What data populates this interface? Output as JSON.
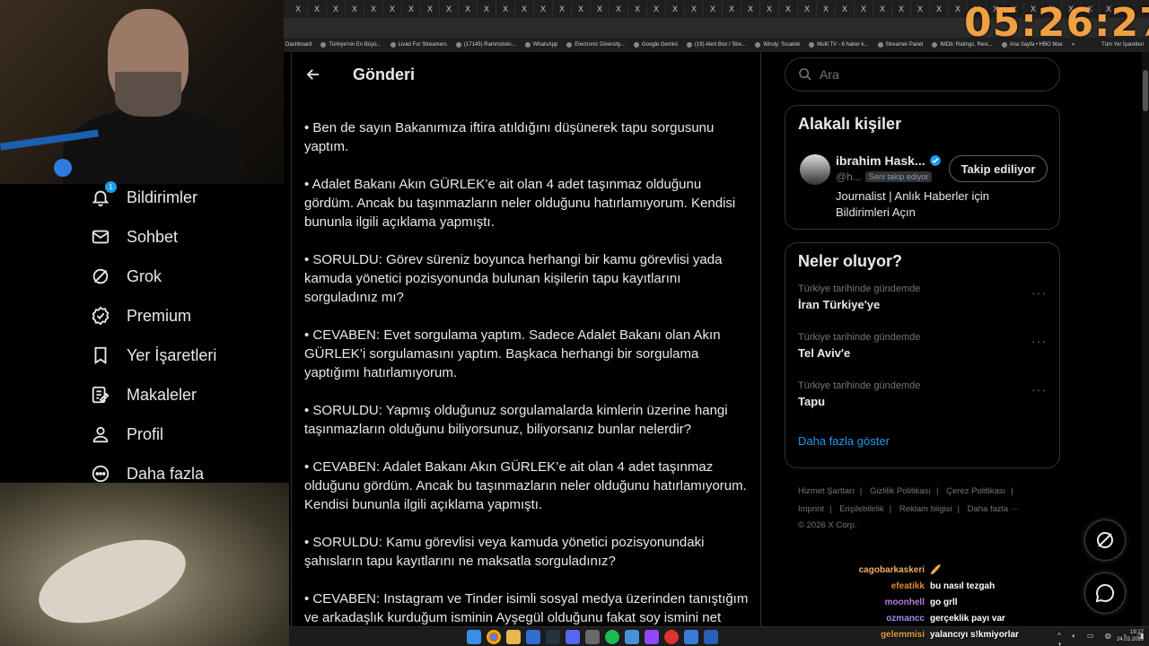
{
  "clock": "05:26:27",
  "browser": {
    "tab_close_glyph": "X",
    "tab_count": 44,
    "bookmarks": [
      "Dashboard",
      "Türkiye'nin En Büyü...",
      "Livad For Streamers",
      "(17145) Rammstein...",
      "WhatsApp",
      "Electronic Diversity...",
      "Google Gemini",
      "(19) Alert Box / Stre...",
      "Windy: Sıcaklık",
      "Multi TV - 6 haber k...",
      "Streamer Panel",
      "IMDb: Ratings, Revi...",
      "Ana Sayfa • HBO Max",
      "»",
      "Tüm Yer İşaretleri"
    ]
  },
  "nav": {
    "items": [
      {
        "label": "Bildirimler",
        "icon": "bell-icon",
        "badge": "1"
      },
      {
        "label": "Sohbet",
        "icon": "mail-icon"
      },
      {
        "label": "Grok",
        "icon": "grok-icon"
      },
      {
        "label": "Premium",
        "icon": "verified-icon"
      },
      {
        "label": "Yer İşaretleri",
        "icon": "bookmark-icon"
      },
      {
        "label": "Makaleler",
        "icon": "article-icon"
      },
      {
        "label": "Profil",
        "icon": "person-icon"
      },
      {
        "label": "Daha fazla",
        "icon": "more-circle-icon"
      }
    ]
  },
  "main": {
    "title": "Gönderi",
    "paragraphs": [
      "• Ben de sayın Bakanımıza iftira atıldığını düşünerek tapu sorgusunu yaptım.",
      "• Adalet Bakanı Akın GÜRLEK’e ait olan 4 adet taşınmaz olduğunu gördüm. Ancak bu taşınmazların neler olduğunu hatırlamıyorum. Kendisi bununla ilgili açıklama yapmıştı.",
      "• SORULDU: Görev süreniz boyunca herhangi bir kamu görevlisi yada kamuda yönetici pozisyonunda bulunan kişilerin tapu kayıtlarını sorguladınız mı?",
      "• CEVABEN: Evet sorgulama yaptım. Sadece Adalet Bakanı olan Akın GÜRLEK’i sorgulamasını yaptım. Başkaca herhangi bir sorgulama yaptığımı hatırlamıyorum.",
      "• SORULDU: Yapmış olduğunuz sorgulamalarda kimlerin üzerine hangi taşınmazların olduğunu biliyorsunuz, biliyorsanız bunlar nelerdir?",
      "• CEVABEN: Adalet Bakanı Akın GÜRLEK’e ait olan 4 adet taşınmaz olduğunu gördüm. Ancak bu taşınmazların neler olduğunu hatırlamıyorum. Kendisi bununla ilgili açıklama yapmıştı.",
      "• SORULDU: Kamu görevlisi veya kamuda yönetici pozisyonundaki şahısların tapu kayıtlarını ne maksatla sorguladınız?",
      "• CEVABEN: Instagram ve Tinder isimli sosyal medya üzerinden tanıştığım ve arkadaşlık kurduğum isminin Ayşegül olduğunu fakat soy ismini net"
    ]
  },
  "search": {
    "placeholder": "Ara"
  },
  "related": {
    "title": "Alakalı kişiler",
    "name": "ibrahim Hask...",
    "handle": "@h...",
    "follows_you": "Seni takip ediyor",
    "follow_label": "Takip ediliyor",
    "bio": "Journalist | Anlık Haberler için Bildirimleri Açın"
  },
  "trends": {
    "title": "Neler oluyor?",
    "items": [
      {
        "context": "Türkiye tarihinde gündemde",
        "topic": "İran Türkiye'ye"
      },
      {
        "context": "Türkiye tarihinde gündemde",
        "topic": "Tel Aviv'e"
      },
      {
        "context": "Türkiye tarihinde gündemde",
        "topic": "Tapu"
      }
    ],
    "show_more": "Daha fazla göster"
  },
  "footer": {
    "links": [
      "Hizmet Şartları",
      "Gizlilik Politikası",
      "Çerez Politikası",
      "Imprint",
      "Erişilebilirlik",
      "Reklam bilgisi",
      "Daha fazla ···"
    ],
    "copyright": "© 2026 X Corp."
  },
  "chat": [
    {
      "user": "cagobarkaskeri",
      "msg": "🥖",
      "color": "#f0b060"
    },
    {
      "user": "efeatikk",
      "msg": "bu nasıl tezgah",
      "color": "#e08a30"
    },
    {
      "user": "moonhell",
      "msg": "go grll",
      "color": "#b87ae0"
    },
    {
      "user": "ozmancc",
      "msg": "gerçeklik payı var",
      "color": "#a88ae8"
    },
    {
      "user": "gelemmisi",
      "msg": "yalancıyı s!kmiyorlar",
      "color": "#e0a040"
    }
  ],
  "taskbar": {
    "time": "19:17",
    "date": "24.03.2026"
  }
}
